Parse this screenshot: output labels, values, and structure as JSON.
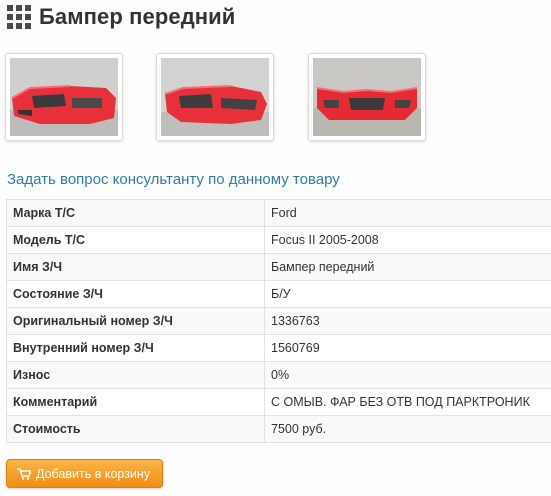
{
  "page": {
    "title": "Бампер передний",
    "icon": "grid-icon"
  },
  "gallery": {
    "images": [
      {
        "name": "bumper-photo-front-left",
        "color": "#e8303a"
      },
      {
        "name": "bumper-photo-front-right",
        "color": "#e8303a"
      },
      {
        "name": "bumper-photo-front-center",
        "color": "#e52a34"
      }
    ]
  },
  "ask_link": "Задать вопрос консультанту по данному товару",
  "specs": [
    {
      "key": "Марка Т/С",
      "value": "Ford"
    },
    {
      "key": "Модель Т/С",
      "value": "Focus II 2005-2008"
    },
    {
      "key": "Имя З/Ч",
      "value": "Бампер передний"
    },
    {
      "key": "Состояние З/Ч",
      "value": "Б/У"
    },
    {
      "key": "Оригинальный номер З/Ч",
      "value": "1336763"
    },
    {
      "key": "Внутренний номер З/Ч",
      "value": "1560769"
    },
    {
      "key": "Износ",
      "value": "0%"
    },
    {
      "key": "Комментарий",
      "value": "С ОМЫВ. ФАР БЕЗ ОТВ ПОД ПАРКТРОНИК"
    },
    {
      "key": "Стоимость",
      "value": "7500 руб."
    }
  ],
  "cart_button": {
    "label": "Добавить в корзину",
    "icon": "cart-icon",
    "color": "#f39c1f"
  }
}
